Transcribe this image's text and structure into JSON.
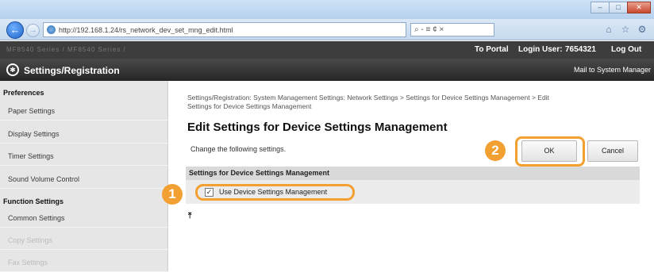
{
  "browser": {
    "url": "http://192.168.1.24/rs_network_dev_set_mng_edit.html",
    "url_tools": "⌕ - ≡ ¢ ×",
    "window_buttons": [
      "–",
      "□",
      "✕"
    ],
    "nav_back_glyph": "←",
    "nav_fwd_glyph": "→",
    "toolbar_icons": [
      "⌂",
      "☆",
      "⚙"
    ]
  },
  "header": {
    "device_name": "MF8540 Series / MF8540 Series /",
    "to_portal": "To Portal",
    "login_label": "Login User:",
    "login_user": "7654321",
    "logout": "Log Out",
    "section_title": "Settings/Registration",
    "mail_link": "Mail to System Manager"
  },
  "sidebar": {
    "preferences_heading": "Preferences",
    "preferences_items": [
      "Paper Settings",
      "Display Settings",
      "Timer Settings",
      "Sound Volume Control"
    ],
    "function_heading": "Function Settings",
    "function_items": [
      "Common Settings",
      "Copy Settings",
      "Fax Settings"
    ]
  },
  "main": {
    "breadcrumb_line1": "Settings/Registration: System Management Settings: Network Settings > Settings for Device Settings Management > Edit",
    "breadcrumb_line2": "Settings for Device Settings Management",
    "title": "Edit Settings for Device Settings Management",
    "instruction": "Change the following settings.",
    "ok_label": "OK",
    "cancel_label": "Cancel",
    "group_header": "Settings for Device Settings Management",
    "checkbox_label": "Use Device Settings Management",
    "checkbox_checked": true,
    "checkbox_glyph": "✓",
    "to_top_glyph": "⤒"
  },
  "callouts": {
    "step1": "1",
    "step2": "2",
    "color": "#f3a032"
  }
}
